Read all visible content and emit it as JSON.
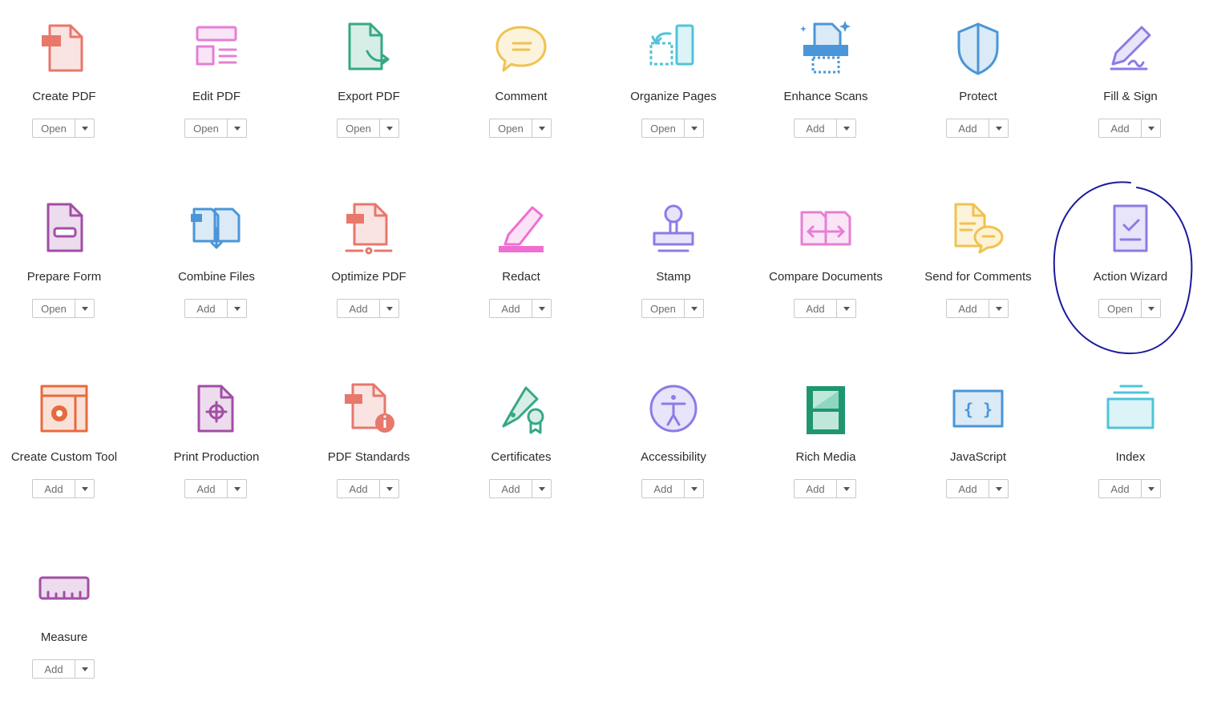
{
  "tools": [
    {
      "id": "create-pdf",
      "label": "Create PDF",
      "action": "Open",
      "icon": "create-pdf-icon",
      "color": "#e8776c"
    },
    {
      "id": "edit-pdf",
      "label": "Edit PDF",
      "action": "Open",
      "icon": "edit-pdf-icon",
      "color": "#e67fd5"
    },
    {
      "id": "export-pdf",
      "label": "Export PDF",
      "action": "Open",
      "icon": "export-pdf-icon",
      "color": "#35a887"
    },
    {
      "id": "comment",
      "label": "Comment",
      "action": "Open",
      "icon": "comment-icon",
      "color": "#f0c24f"
    },
    {
      "id": "organize-pages",
      "label": "Organize Pages",
      "action": "Open",
      "icon": "organize-pages-icon",
      "color": "#4fc4d9"
    },
    {
      "id": "enhance-scans",
      "label": "Enhance Scans",
      "action": "Add",
      "icon": "enhance-scans-icon",
      "color": "#4a96d8"
    },
    {
      "id": "protect",
      "label": "Protect",
      "action": "Add",
      "icon": "protect-icon",
      "color": "#4a96d8"
    },
    {
      "id": "fill-sign",
      "label": "Fill & Sign",
      "action": "Add",
      "icon": "fill-sign-icon",
      "color": "#8e7ae6"
    },
    {
      "id": "prepare-form",
      "label": "Prepare Form",
      "action": "Open",
      "icon": "prepare-form-icon",
      "color": "#a24ea5"
    },
    {
      "id": "combine-files",
      "label": "Combine Files",
      "action": "Add",
      "icon": "combine-files-icon",
      "color": "#4a96d8"
    },
    {
      "id": "optimize-pdf",
      "label": "Optimize PDF",
      "action": "Add",
      "icon": "optimize-pdf-icon",
      "color": "#e8776c"
    },
    {
      "id": "redact",
      "label": "Redact",
      "action": "Add",
      "icon": "redact-icon",
      "color": "#ef6fd0"
    },
    {
      "id": "stamp",
      "label": "Stamp",
      "action": "Open",
      "icon": "stamp-icon",
      "color": "#8e7ae6"
    },
    {
      "id": "compare-documents",
      "label": "Compare Documents",
      "action": "Add",
      "icon": "compare-documents-icon",
      "color": "#e67fd5"
    },
    {
      "id": "send-for-comments",
      "label": "Send for Comments",
      "action": "Add",
      "icon": "send-for-comments-icon",
      "color": "#f0c24f"
    },
    {
      "id": "action-wizard",
      "label": "Action Wizard",
      "action": "Open",
      "icon": "action-wizard-icon",
      "color": "#8e7ae6"
    },
    {
      "id": "create-custom-tool",
      "label": "Create Custom Tool",
      "action": "Add",
      "icon": "create-custom-tool-icon",
      "color": "#e86a3c"
    },
    {
      "id": "print-production",
      "label": "Print Production",
      "action": "Add",
      "icon": "print-production-icon",
      "color": "#a24ea5"
    },
    {
      "id": "pdf-standards",
      "label": "PDF Standards",
      "action": "Add",
      "icon": "pdf-standards-icon",
      "color": "#e8776c"
    },
    {
      "id": "certificates",
      "label": "Certificates",
      "action": "Add",
      "icon": "certificates-icon",
      "color": "#35a887"
    },
    {
      "id": "accessibility",
      "label": "Accessibility",
      "action": "Add",
      "icon": "accessibility-icon",
      "color": "#8e7ae6"
    },
    {
      "id": "rich-media",
      "label": "Rich Media",
      "action": "Add",
      "icon": "rich-media-icon",
      "color": "#1f9670"
    },
    {
      "id": "javascript",
      "label": "JavaScript",
      "action": "Add",
      "icon": "javascript-icon",
      "color": "#4a96d8"
    },
    {
      "id": "index",
      "label": "Index",
      "action": "Add",
      "icon": "index-icon",
      "color": "#4fc4d9"
    },
    {
      "id": "measure",
      "label": "Measure",
      "action": "Add",
      "icon": "measure-icon",
      "color": "#a24ea5"
    }
  ],
  "annotation": {
    "shape": "hand-drawn-circle",
    "target": "action-wizard",
    "color": "#1a1a9e"
  }
}
